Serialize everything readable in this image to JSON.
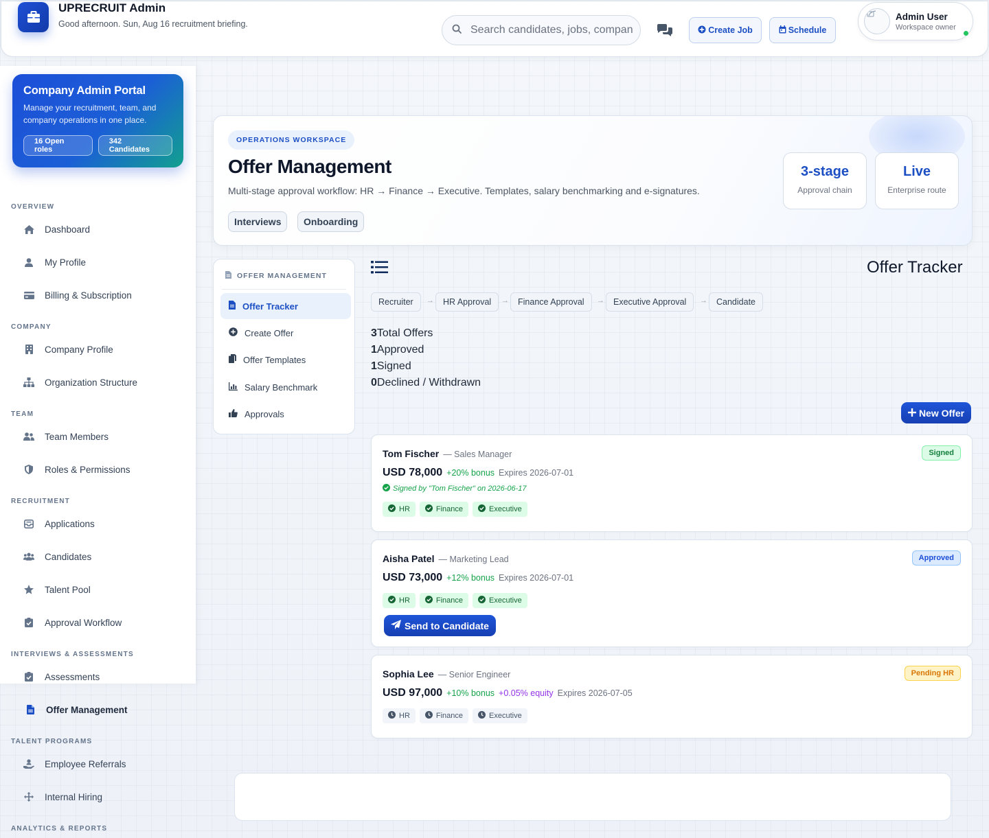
{
  "header": {
    "brand_title": "UPRECRUIT Admin",
    "brand_subtitle": "Good afternoon. Sun, Aug 16 recruitment briefing.",
    "search_placeholder": "Search candidates, jobs, companies...",
    "create_job_label": "Create Job",
    "schedule_label": "Schedule",
    "user_name": "Admin User",
    "user_role": "Workspace owner"
  },
  "sidebar": {
    "portal": {
      "title": "Company Admin Portal",
      "description": "Manage your recruitment, team, and company operations in one place.",
      "open_roles": "16 Open roles",
      "candidates": "342 Candidates"
    },
    "sections": {
      "overview": "OVERVIEW",
      "company": "COMPANY",
      "team": "TEAM",
      "recruitment": "RECRUITMENT",
      "interviews": "INTERVIEWS & ASSESSMENTS",
      "talent": "TALENT PROGRAMS",
      "analytics": "ANALYTICS & REPORTS"
    },
    "items": {
      "dashboard": "Dashboard",
      "my_profile": "My Profile",
      "billing": "Billing & Subscription",
      "company_profile": "Company Profile",
      "org_structure": "Organization Structure",
      "team_members": "Team Members",
      "roles": "Roles & Permissions",
      "applications": "Applications",
      "candidates": "Candidates",
      "talent_pool": "Talent Pool",
      "approval_workflow": "Approval Workflow",
      "assessments": "Assessments",
      "offer_management": "Offer Management",
      "employee_referrals": "Employee Referrals",
      "internal_hiring": "Internal Hiring"
    }
  },
  "hero": {
    "eyebrow": "OPERATIONS WORKSPACE",
    "title": "Offer Management",
    "subtitle": "Multi-stage approval workflow: HR → Finance → Executive. Templates, salary benchmarking and e-signatures.",
    "tags": [
      "Interviews",
      "Onboarding"
    ],
    "stats": [
      {
        "value": "3-stage",
        "label": "Approval chain"
      },
      {
        "value": "Live",
        "label": "Enterprise route"
      }
    ]
  },
  "subnav": {
    "heading": "OFFER MANAGEMENT",
    "items": [
      "Offer Tracker",
      "Create Offer",
      "Offer Templates",
      "Salary Benchmark",
      "Approvals"
    ]
  },
  "tracker": {
    "title": "Offer Tracker",
    "stages": [
      "Recruiter",
      "HR Approval",
      "Finance Approval",
      "Executive Approval",
      "Candidate"
    ],
    "stage_arrow": "→",
    "stats": [
      {
        "value": "3",
        "label": "Total Offers"
      },
      {
        "value": "1",
        "label": "Approved"
      },
      {
        "value": "1",
        "label": "Signed"
      },
      {
        "value": "0",
        "label": "Declined / Withdrawn"
      }
    ],
    "new_offer_label": "New Offer",
    "offers": [
      {
        "name": "Tom Fischer",
        "role": "— Sales Manager",
        "salary": "USD 78,000",
        "bonus": "+20% bonus",
        "equity": "",
        "expires": "Expires 2026-07-01",
        "status": "Signed",
        "signed_note": "Signed by \"Tom Fischer\" on 2026-06-17",
        "approvals": [
          "HR",
          "Finance",
          "Executive"
        ]
      },
      {
        "name": "Aisha Patel",
        "role": "— Marketing Lead",
        "salary": "USD 73,000",
        "bonus": "+12% bonus",
        "equity": "",
        "expires": "Expires 2026-07-01",
        "status": "Approved",
        "approvals": [
          "HR",
          "Finance",
          "Executive"
        ],
        "action_label": "Send to Candidate"
      },
      {
        "name": "Sophia Lee",
        "role": "— Senior Engineer",
        "salary": "USD 97,000",
        "bonus": "+10% bonus",
        "equity": "+0.05% equity",
        "expires": "Expires 2026-07-05",
        "status": "Pending HR",
        "approvals": [
          "HR",
          "Finance",
          "Executive"
        ]
      }
    ]
  },
  "colors": {
    "accent": "#1d4fc4",
    "success": "#16a34a",
    "warning": "#d97706",
    "equity": "#9333ea"
  }
}
